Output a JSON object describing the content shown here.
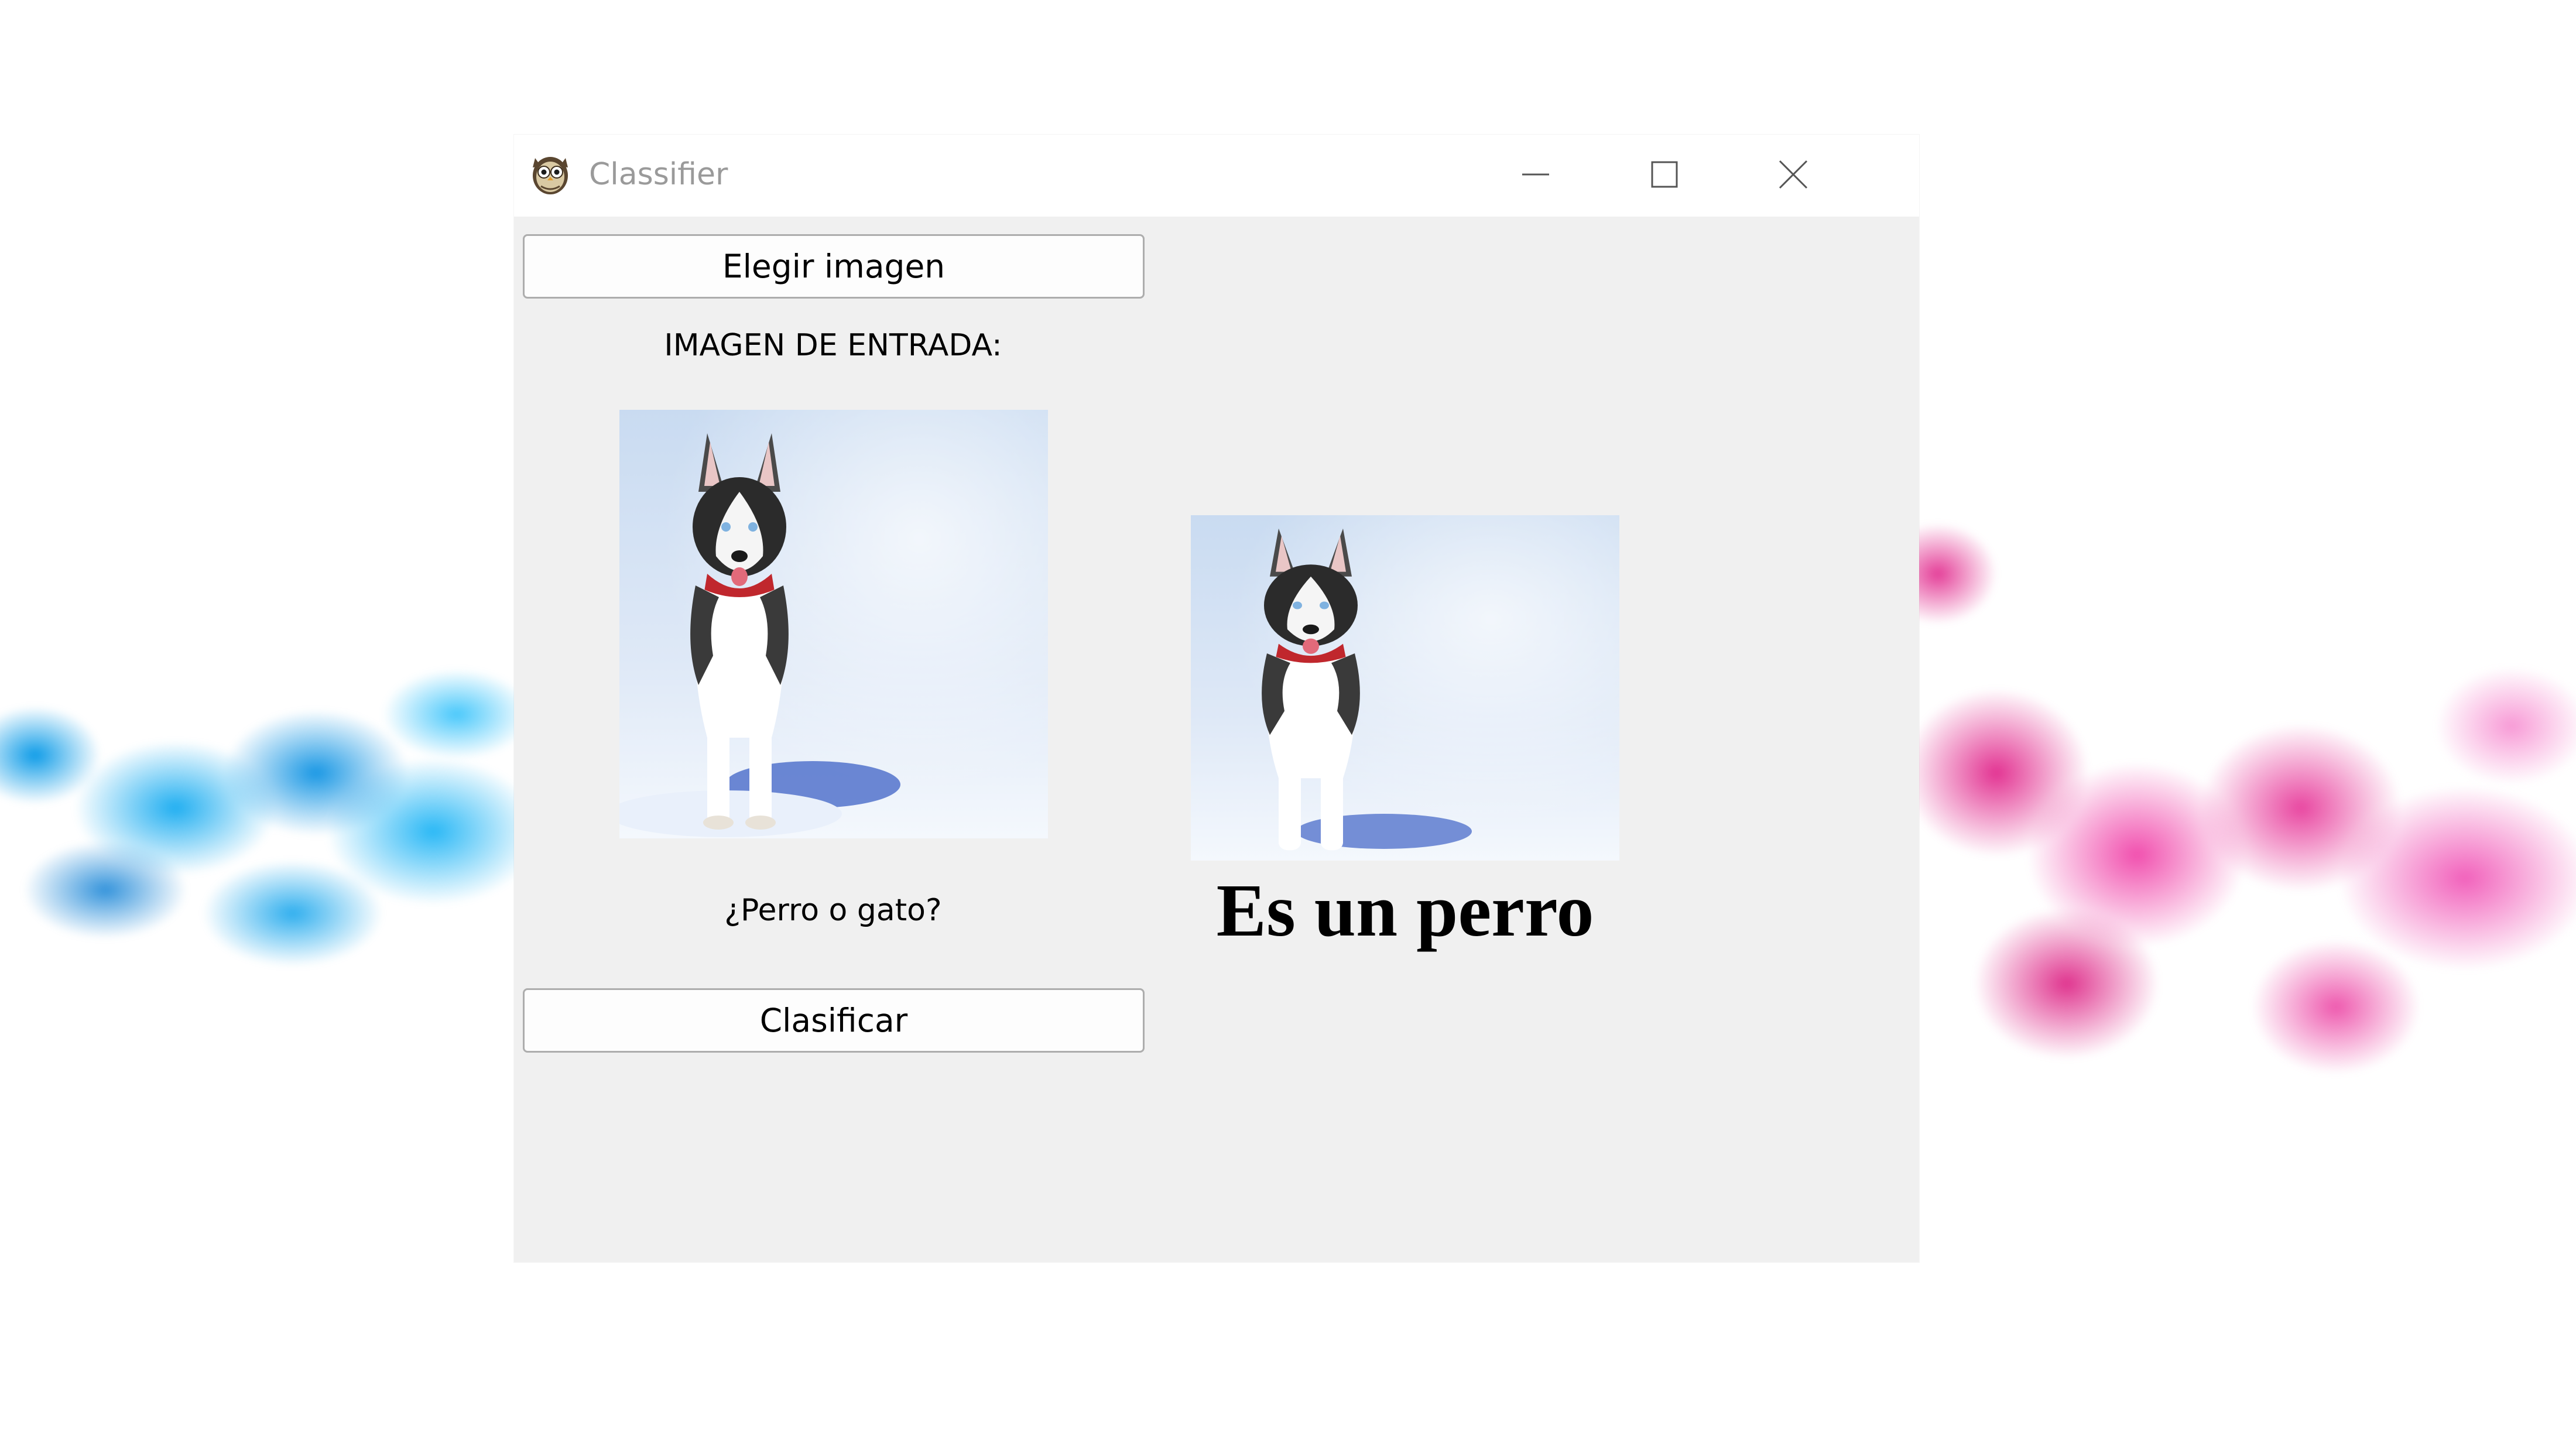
{
  "window": {
    "title": "Classifier",
    "app_icon": "owl-app-icon",
    "controls": {
      "minimize_icon": "minimize-icon",
      "maximize_icon": "maximize-icon",
      "close_icon": "close-icon"
    }
  },
  "main": {
    "choose_button_label": "Elegir imagen",
    "input_label": "IMAGEN DE ENTRADA:",
    "input_image": "husky-dog-in-snow",
    "question_label": "¿Perro o gato?",
    "classify_button_label": "Clasificar",
    "output_image": "husky-dog-in-snow",
    "result_text": "Es un perro"
  },
  "background": {
    "left_ink_color": "#14a8ec",
    "right_ink_color": "#e6329a"
  },
  "colors": {
    "window_bg": "#f0f0f0",
    "titlebar_bg": "#ffffff",
    "title_text": "#9a9a9a",
    "button_border": "#adadad"
  }
}
